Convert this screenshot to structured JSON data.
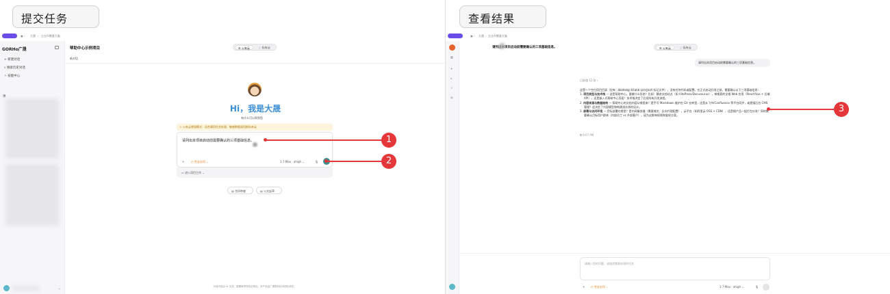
{
  "labels": {
    "submit": "提交任务",
    "result": "查看结果"
  },
  "breadcrumb": {
    "root": "大晟",
    "page": "企业AI需要大脑"
  },
  "left": {
    "brand": "GORHo广晟",
    "sidebar": {
      "new_chat": "新建对话",
      "search": "搜索历史对话",
      "skills": "技能中心",
      "recent": "项"
    },
    "header": {
      "title": "帮助中心示例项目",
      "tab_public": "公有云",
      "tab_private": "私有云",
      "subtitle": "新对话"
    },
    "hero": {
      "title": "Hi，我是大晟",
      "subtitle": "有什么可以帮到您"
    },
    "notice": "公有云增强模式：适合通用任务处理，敏感数据请切换私有云",
    "input": {
      "text": "请列出本项目启动前需要确认的三项基础信息。",
      "mode": "完全访问",
      "model": "3.7-Max · ahigh"
    },
    "project": "进入项目工作",
    "chips": [
      "合同审查",
      "公文起草"
    ],
    "footer": "对话内容由 AI 生成，重要事项请务必核实。本产品由广晟数科技术团队研发。"
  },
  "right": {
    "header_title": "请列出本项目启动前需要确认的三项基础信息。",
    "tab_public": "公有云",
    "tab_private": "私有云",
    "user_msg": "请列出本项目启动前需要确认的三项基础信息。",
    "thought": "已处理 12 秒 ›",
    "answer_intro_a": "这是一个空白项目目录（仅有",
    "answer_code": ".dasheng-blank-project",
    "answer_intro_b": "标记文件），没有任何代码或配置。在正式启动开发之前，需要确认以下三项基础信息：",
    "items": [
      {
        "n": "1.",
        "bold": "项目类型与技术栈",
        "rest": "— 这是帮助中心，要做什么形态？比如：静态文档站点（如 VitePress/Docusaurus），带搜索的全栈 Web 应用（React/Vue + 后端 API），还是嵌入式帮助中心页面？技术栈决定了后续所有开发流程。"
      },
      {
        "n": "2.",
        "bold": "内容来源与数据结构",
        "rest": "— 帮助中心的文档内容从哪里来？是手写 Markdown 维护在 Git 仓库里，还是从飞书/Confluence 等平台同步，或是接后台 CMS 管理？这决定了内容模型和构建流水线的设计。"
      },
      {
        "n": "3.",
        "bold": "部署与访问环境",
        "rest": "— 目标部署在哪里？是内网服务器（需要域名、反向代理配置），云平台（如阿里云 OSS + CDN），还是随产品一起打包分发？同时需要确认目标用户群体（内部员工 vs 外部客户），因为这影响权限和鉴权方案。"
      }
    ],
    "time": "9:07 PM",
    "input_placeholder": "请输入您的问题，或描述需要处理的任务",
    "mode": "完全访问",
    "model": "3.7-Max · ahigh"
  },
  "callouts": [
    "1",
    "2",
    "3"
  ],
  "colors": {
    "accent": "#6a4de8",
    "brand_blue": "#3b8fd8",
    "red": "#e5373a",
    "orange": "#e07b1a"
  }
}
